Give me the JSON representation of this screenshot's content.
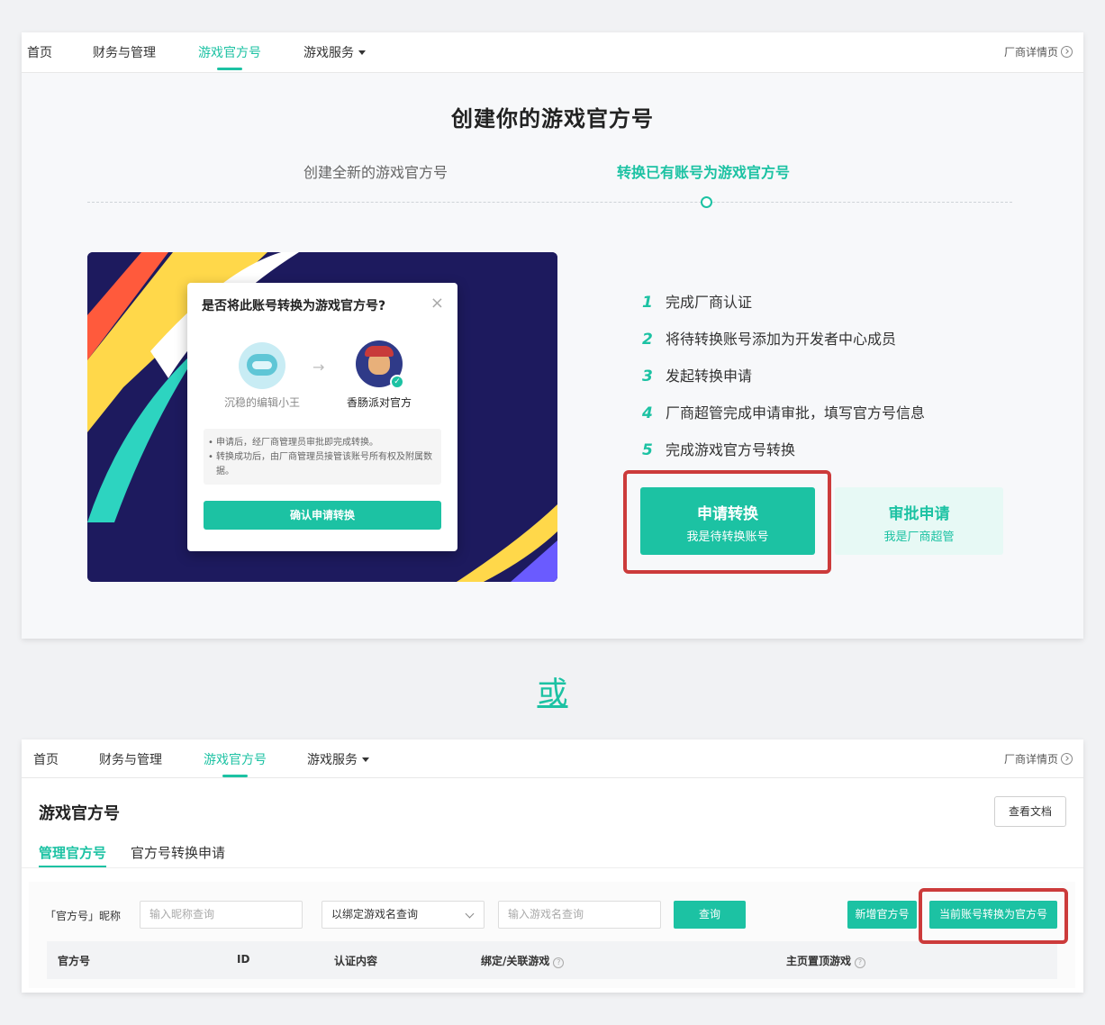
{
  "nav": {
    "items": [
      "首页",
      "财务与管理",
      "游戏官方号",
      "游戏服务"
    ],
    "vendor_link": "厂商详情页"
  },
  "create": {
    "title": "创建你的游戏官方号",
    "tabs": [
      "创建全新的游戏官方号",
      "转换已有账号为游戏官方号"
    ],
    "active_tab": 1
  },
  "dialog": {
    "title": "是否将此账号转换为游戏官方号?",
    "close": "×",
    "from_name": "沉稳的编辑小王",
    "to_name": "香肠派对官方",
    "notes": [
      "申请后，经厂商管理员审批即完成转换。",
      "转换成功后，由厂商管理员接管该账号所有权及附属数据。"
    ],
    "confirm": "确认申请转换"
  },
  "steps": [
    {
      "num": "1",
      "text": "完成厂商认证"
    },
    {
      "num": "2",
      "text": "将待转换账号添加为开发者中心成员"
    },
    {
      "num": "3",
      "text": "发起转换申请"
    },
    {
      "num": "4",
      "text": "厂商超管完成申请审批，填写官方号信息"
    },
    {
      "num": "5",
      "text": "完成游戏官方号转换"
    }
  ],
  "apply_button": {
    "main": "申请转换",
    "sub": "我是待转换账号"
  },
  "approve_button": {
    "main": "审批申请",
    "sub": "我是厂商超管"
  },
  "or_text": "或",
  "manage": {
    "title": "游戏官方号",
    "doc_button": "查看文档",
    "tabs": [
      "管理官方号",
      "官方号转换申请"
    ],
    "filter_label": "「官方号」昵称",
    "nickname_placeholder": "输入昵称查询",
    "select_value": "以绑定游戏名查询",
    "game_placeholder": "输入游戏名查询",
    "query_button": "查询",
    "add_button": "新增官方号",
    "convert_button": "当前账号转换为官方号",
    "columns": [
      "官方号",
      "ID",
      "认证内容",
      "绑定/关联游戏",
      "主页置顶游戏"
    ]
  },
  "colors": {
    "accent": "#1cc2a3",
    "highlight": "#cc3b3b"
  }
}
